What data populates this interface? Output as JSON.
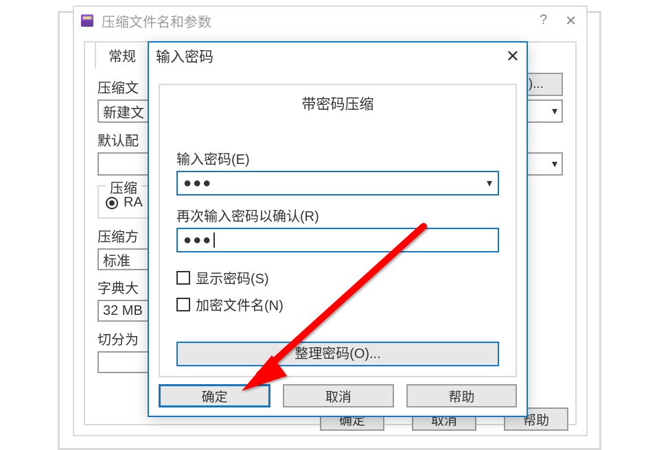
{
  "parent": {
    "title": "压缩文件名和参数",
    "tab_general": "常规",
    "label_archive_name": "压缩文",
    "archive_name_value": "新建文",
    "label_default_profile": "默认配",
    "btn_browse_suffix": "B)...",
    "group_format": "压缩",
    "radio_rar": "RA",
    "label_method": "压缩方",
    "method_value": "标准",
    "label_dict": "字典大",
    "dict_value": "32 MB",
    "label_split": "切分为",
    "btn_ok": "确定",
    "btn_cancel": "取消",
    "btn_help": "帮助"
  },
  "modal": {
    "title": "输入密码",
    "body_title": "带密码压缩",
    "label_pw1": "输入密码(E)",
    "pw1_value": "●●●",
    "label_pw2": "再次输入密码以确认(R)",
    "pw2_value": "●●●",
    "cb_show": "显示密码(S)",
    "cb_encrypt_names": "加密文件名(N)",
    "btn_organize": "整理密码(O)...",
    "btn_ok": "确定",
    "btn_cancel": "取消",
    "btn_help": "帮助"
  }
}
